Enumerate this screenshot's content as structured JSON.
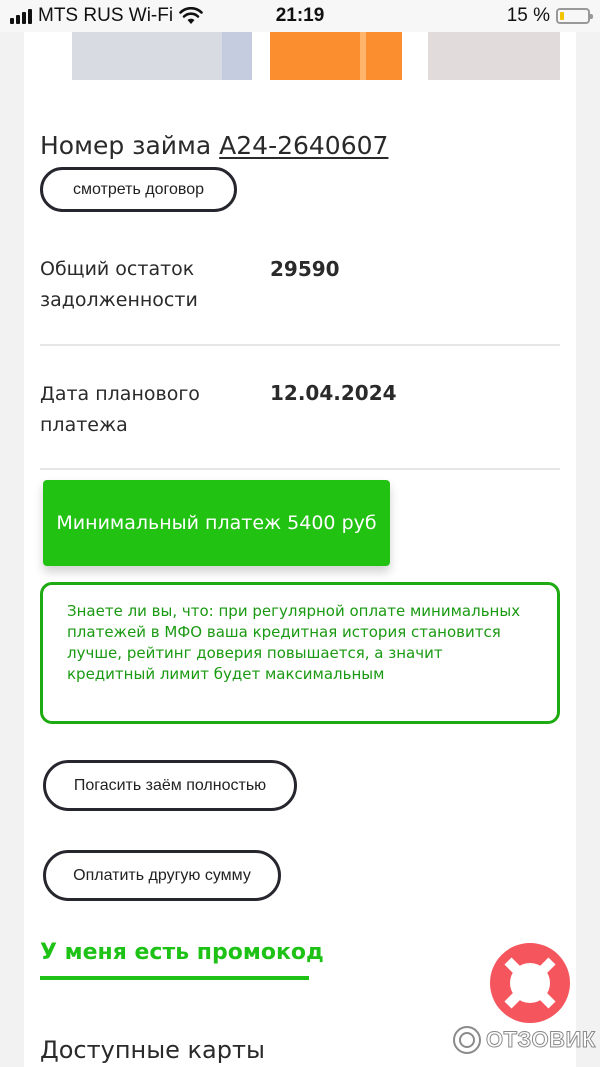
{
  "status_bar": {
    "carrier": "MTS RUS Wi-Fi",
    "time": "21:19",
    "battery_text": "15 %",
    "battery_level": 0.15,
    "battery_color": "#f3c300"
  },
  "loan": {
    "title_prefix": "Номер займа",
    "number": "А24-2640607",
    "view_contract_label": "смотреть договор"
  },
  "details": [
    {
      "label": "Общий остаток задолженности",
      "value": "29590"
    },
    {
      "label": "Дата планового платежа",
      "value": "12.04.2024"
    }
  ],
  "min_payment_label": "Минимальный платеж 5400  руб",
  "tip": "Знаете ли вы, что: при регулярной оплате минимальных платежей в МФО ваша кредитная история становится лучше, рейтинг доверия повышается, а значит кредитный лимит будет максимальным",
  "actions": {
    "repay_full_label": "Погасить заём полностью",
    "pay_other_label": "Оплатить другую сумму"
  },
  "promo_label": "У меня есть промокод",
  "cards_title": "Доступные карты",
  "icons": {
    "help": "lifebuoy-icon",
    "wifi": "wifi-icon",
    "signal": "signal-icon",
    "battery": "battery-icon"
  },
  "colors": {
    "accent_green": "#21c212",
    "tip_green": "#1a9a12",
    "lifebuoy_red": "#f5555d"
  },
  "watermark": "ОТЗОВИК"
}
